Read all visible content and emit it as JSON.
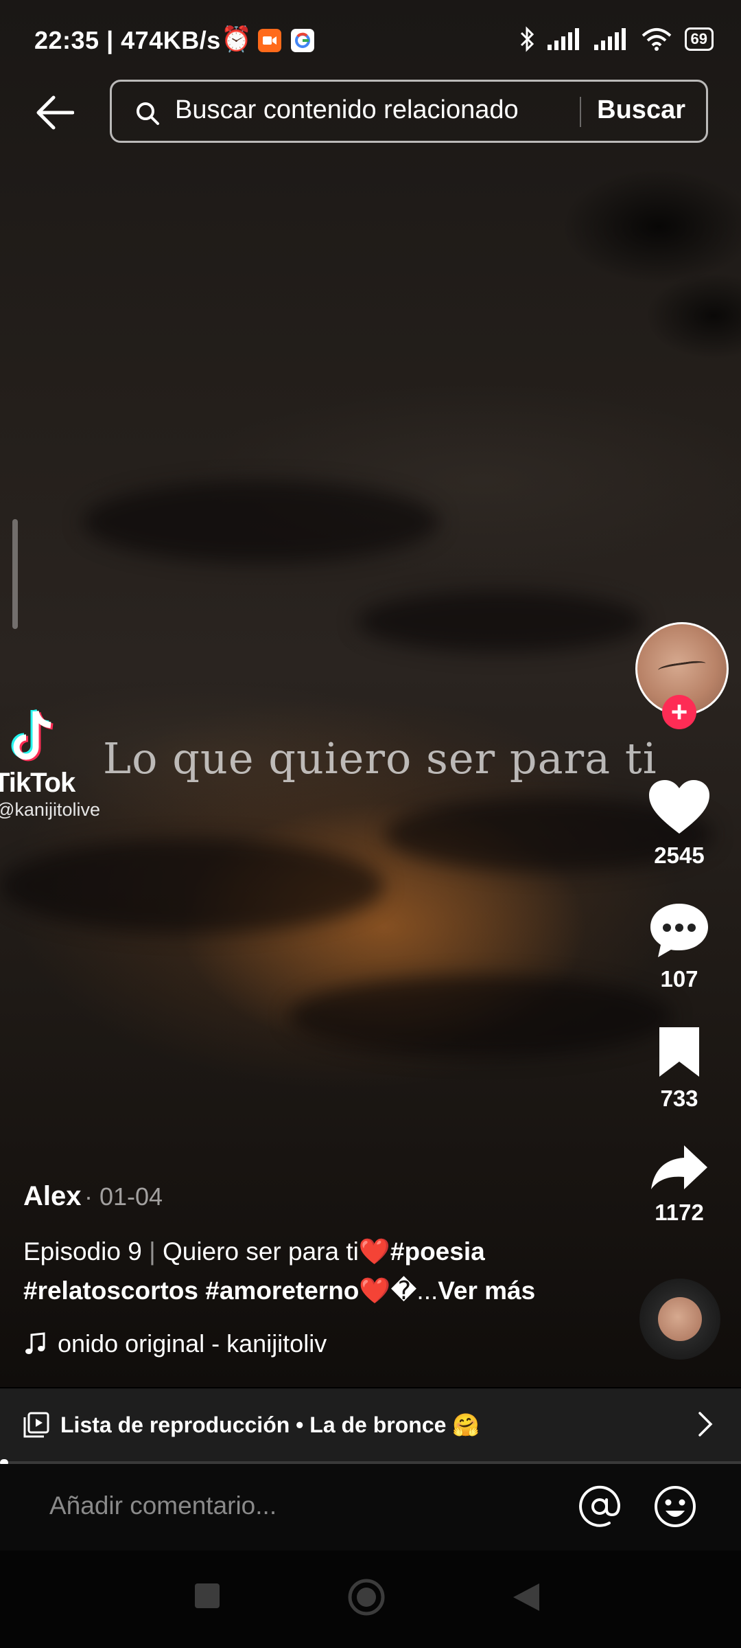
{
  "status_bar": {
    "time_speed": "22:35 | 474KB/s",
    "battery": "69"
  },
  "search": {
    "placeholder": "Buscar contenido relacionado",
    "button_label": "Buscar"
  },
  "watermark": {
    "brand": "TikTok",
    "handle": "@kanijitolive"
  },
  "video_caption": "Lo que quiero ser para ti",
  "actions": {
    "likes": "2545",
    "comments": "107",
    "saves": "733",
    "shares": "1172"
  },
  "post": {
    "username": "Alex",
    "date": "· 01-04",
    "episode": "Episodio 9",
    "separator": "|",
    "title": "Quiero ser para ti❤️",
    "tag_poesia": "#poesia",
    "tag_relatos": "#relatoscortos",
    "tag_amor": "#amoreterno❤️",
    "truncated": "�...",
    "see_more": "Ver más"
  },
  "music": {
    "label": "onido original - kanijitoliv"
  },
  "playlist": {
    "label": "Lista de reproducción • La de bronce 🤗"
  },
  "comment": {
    "placeholder": "Añadir comentario..."
  },
  "colors": {
    "follow_accent": "#fe2c55",
    "background": "#000000"
  }
}
